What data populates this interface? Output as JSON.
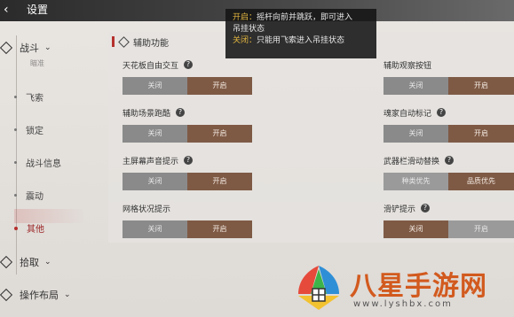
{
  "header": {
    "back_icon": "back-arrow-icon",
    "title": "设置"
  },
  "sidebar": {
    "sections": [
      {
        "label": "战斗",
        "chevron": "⌄"
      },
      {
        "label": "拾取",
        "chevron": "⌄"
      },
      {
        "label": "操作布局",
        "chevron": "⌄"
      }
    ],
    "items": [
      {
        "label": "飞索"
      },
      {
        "label": "锁定"
      },
      {
        "label": "战斗信息"
      },
      {
        "label": "震动"
      },
      {
        "label": "其他"
      }
    ],
    "cut_item_fragment": "瞄准"
  },
  "panel": {
    "title": "辅助功能"
  },
  "toggle_labels": {
    "off": "关闭",
    "on": "开启"
  },
  "settings_left": [
    {
      "label": "天花板自由交互",
      "selected": "on"
    },
    {
      "label": "辅助场景跑酷",
      "selected": "on"
    },
    {
      "label": "主屏幕声音提示",
      "selected": "on"
    },
    {
      "label": "网格状况提示",
      "selected": "on"
    }
  ],
  "settings_right": [
    {
      "label": "辅助观察按钮",
      "selected": "on"
    },
    {
      "label": "魂家自动标记",
      "selected": "on"
    },
    {
      "label": "武器栏滑动替换",
      "selected": "quality",
      "opt_a": "种类优先",
      "opt_b": "品质优先"
    },
    {
      "label": "滑铲提示",
      "selected": "off"
    }
  ],
  "tooltip": {
    "line1_key": "开启：",
    "line1_text": "摇杆向前并跳跃，即可进入",
    "line2_text": "吊挂状态",
    "line3_key": "关闭：",
    "line3_text": "只能用飞索进入吊挂状态"
  },
  "watermark": {
    "brand": "八星手游网",
    "url": "www.lyshbx.com"
  },
  "colors": {
    "accent_red": "#b5302d",
    "on_brown": "#8c6a55",
    "off_gray": "#8a8a8a"
  }
}
